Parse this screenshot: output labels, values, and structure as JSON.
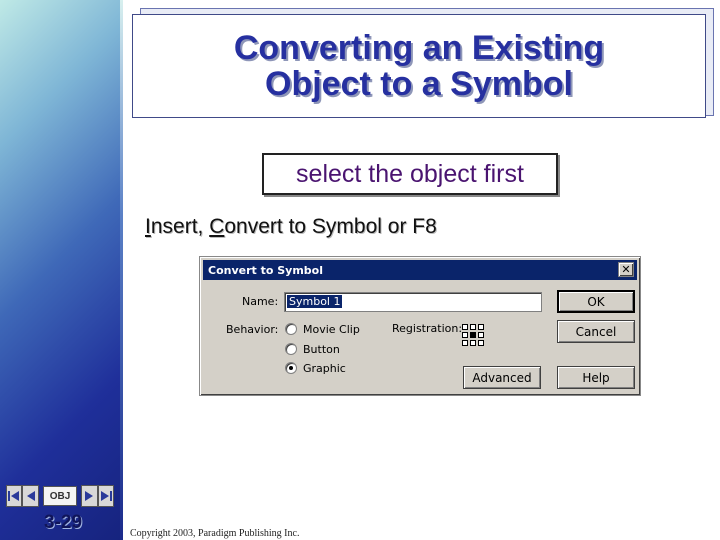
{
  "slide": {
    "title_line1": "Converting an Existing",
    "title_line2": "Object to a Symbol",
    "subtitle": "select the object first",
    "instruction": {
      "insert": "Insert",
      "sep": ", ",
      "convert": "Convert to Symbol or F8",
      "insert_underline": "I",
      "insert_rest": "nsert",
      "convert_underline": "C",
      "convert_rest": "onvert to Symbol or F8"
    },
    "slide_number": "3-29",
    "copyright": "Copyright 2003, Paradigm Publishing Inc."
  },
  "nav": {
    "obj_label": "OBJ",
    "first_icon": "first-page-icon",
    "prev_icon": "prev-page-icon",
    "next_icon": "next-page-icon",
    "last_icon": "last-page-icon"
  },
  "dialog": {
    "title": "Convert to Symbol",
    "close": "✕",
    "name_label": "Name:",
    "name_value": "Symbol 1",
    "behavior_label": "Behavior:",
    "behaviors": [
      "Movie Clip",
      "Button",
      "Graphic"
    ],
    "selected_behavior": "Graphic",
    "registration_label": "Registration:",
    "ok": "OK",
    "cancel": "Cancel",
    "advanced": "Advanced",
    "help": "Help"
  },
  "colors": {
    "title": "#2630a0",
    "subtitle": "#4a1470",
    "dialog_title_bg": "#0a246a"
  }
}
